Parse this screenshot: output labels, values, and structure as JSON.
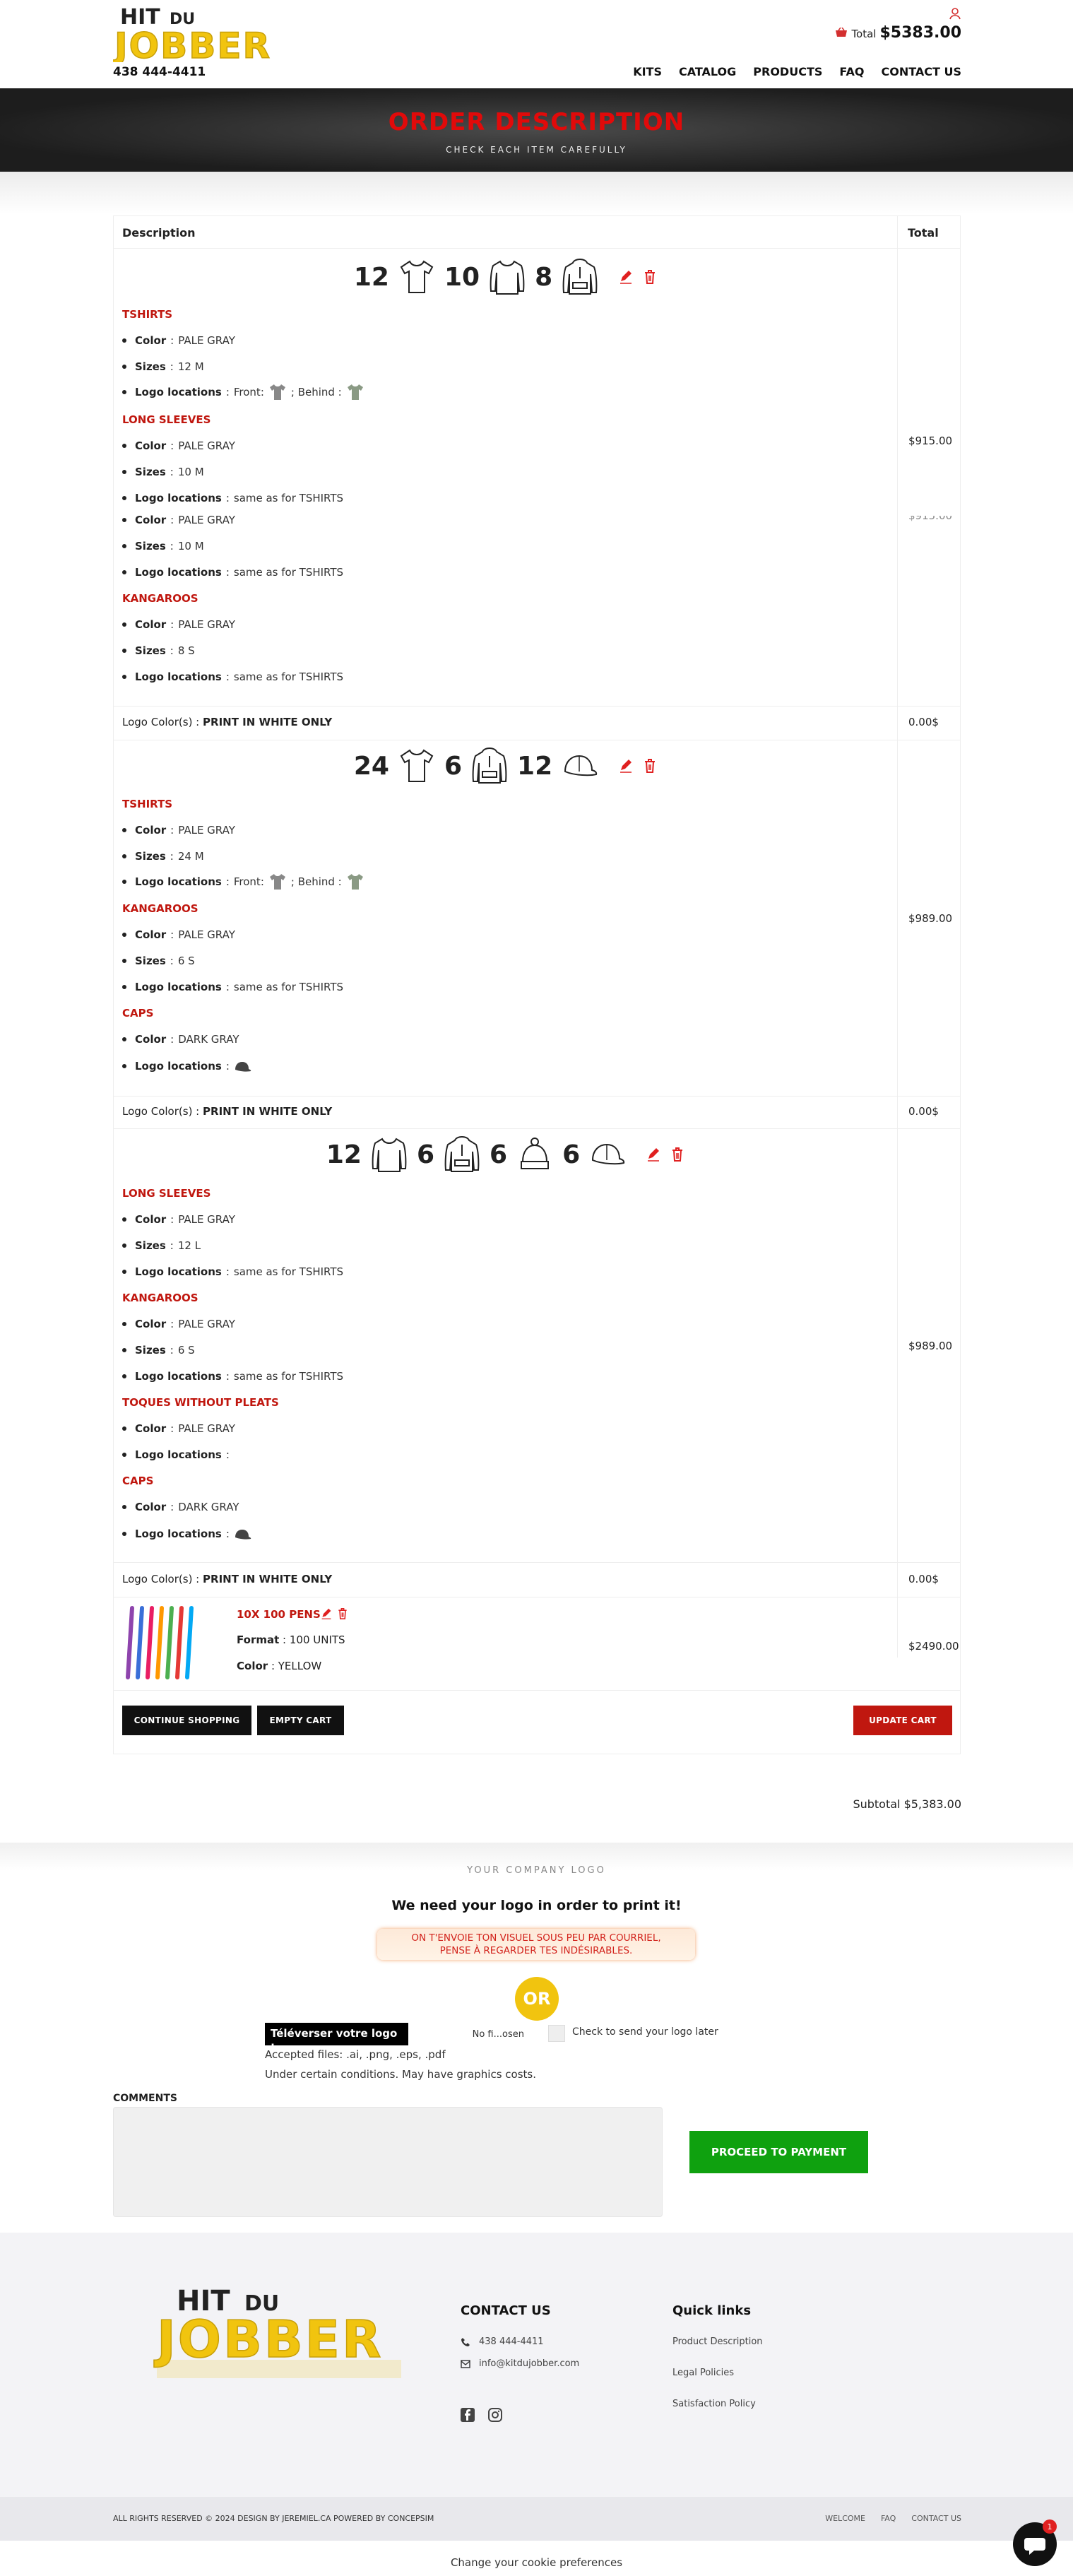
{
  "header": {
    "logo_alt": "Kit du Jobber",
    "phone": "438 444-4411",
    "cart_label": "Total",
    "cart_total": "$5383.00",
    "nav": [
      "KITS",
      "CATALOG",
      "PRODUCTS",
      "FAQ",
      "CONTACT US"
    ]
  },
  "banner": {
    "title": "ORDER DESCRIPTION",
    "subtitle": "CHECK EACH ITEM CAREFULLY"
  },
  "table": {
    "col_description": "Description",
    "col_total": "Total",
    "logo_color_label": "Logo Color(s) :",
    "logo_color_value": "PRINT IN WHITE ONLY",
    "logo_color_price": "0.00$"
  },
  "item1": {
    "quantities": [
      "12",
      "10",
      "8"
    ],
    "price_a": "$915.00",
    "price_b": "$915.00",
    "sections": [
      {
        "title": "TSHIRTS",
        "color": "PALE GRAY",
        "sizes": "12 M",
        "front": "Front:",
        "behind": "; Behind :"
      },
      {
        "title": "LONG SLEEVES",
        "color": "PALE GRAY",
        "sizes": "10 M",
        "logo": "same as for TSHIRTS"
      },
      {
        "title": "",
        "color": "PALE GRAY",
        "sizes": "10 M",
        "logo": "same as for TSHIRTS"
      },
      {
        "title": "KANGAROOS",
        "color": "PALE GRAY",
        "sizes": "8 S",
        "logo": "same as for TSHIRTS"
      }
    ]
  },
  "item2": {
    "quantities": [
      "24",
      "6",
      "12"
    ],
    "price": "$989.00",
    "sections": [
      {
        "title": "TSHIRTS",
        "color": "PALE GRAY",
        "sizes": "24 M",
        "front": "Front:",
        "behind": "; Behind :"
      },
      {
        "title": "KANGAROOS",
        "color": "PALE GRAY",
        "sizes": "6 S",
        "logo": "same as for TSHIRTS"
      },
      {
        "title": "CAPS",
        "color": "DARK GRAY"
      }
    ]
  },
  "item3": {
    "quantities": [
      "12",
      "6",
      "6",
      "6"
    ],
    "price": "$989.00",
    "sections": [
      {
        "title": "LONG SLEEVES",
        "color": "PALE GRAY",
        "sizes": "12 L",
        "logo": "same as for TSHIRTS"
      },
      {
        "title": "KANGAROOS",
        "color": "PALE GRAY",
        "sizes": "6 S",
        "logo": "same as for TSHIRTS"
      },
      {
        "title": "TOQUES WITHOUT PLEATS",
        "color": "PALE GRAY"
      },
      {
        "title": "CAPS",
        "color": "DARK GRAY"
      }
    ]
  },
  "item4": {
    "title": "10X 100 PENS",
    "format_label": "Format",
    "format": "100 UNITS",
    "color_label": "Color",
    "color": "YELLOW",
    "price": "$2490.00"
  },
  "labels": {
    "color": "Color",
    "sizes": "Sizes",
    "logo_locations": "Logo locations"
  },
  "buttons": {
    "continue": "CONTINUE SHOPPING",
    "empty": "EMPTY CART",
    "update": "UPDATE CART"
  },
  "subtotal": "Subtotal $5,383.00",
  "logo_section": {
    "small_title": "YOUR COMPANY LOGO",
    "heading": "We need your logo in order to print it!",
    "badge_line1": "ON T'ENVOIE TON VISUEL SOUS PEU PAR COURRIEL,",
    "badge_line2": "PENSE À REGARDER TES INDÉSIRABLES.",
    "or": "OR",
    "upload_label": "Téléverser votre logo :",
    "file_status": "No fi...osen",
    "checkbox_label": "Check to send your logo later",
    "accepted": "Accepted files: .ai, .png, .eps, .pdf",
    "conditions": "Under certain conditions. May have graphics costs."
  },
  "comments": {
    "title": "COMMENTS",
    "pay_button": "PROCEED TO PAYMENT"
  },
  "footer": {
    "contact_title": "CONTACT US",
    "phone": "438 444-4411",
    "email": "info@kitdujobber.com",
    "links_title": "Quick links",
    "links": [
      "Product Description",
      "Legal Policies",
      "Satisfaction Policy"
    ],
    "copyright": "ALL RIGHTS RESERVED © 2024 DESIGN BY JEREMIEL.CA POWERED BY CONCEPSIM",
    "bottom_links": [
      "WELCOME",
      "FAQ",
      "CONTACT US"
    ],
    "cookie": "Change your cookie preferences",
    "chat_badge": "1"
  },
  "colors": {
    "accent_red": "#c0170f",
    "banner_red": "#e10a0a",
    "brand_yellow": "#f1c40f",
    "pay_green": "#0fa10f"
  },
  "icons": [
    "user-icon",
    "cart-icon",
    "edit-icon",
    "trash-icon",
    "tshirt-icon",
    "long-sleeve-icon",
    "hoodie-icon",
    "cap-icon",
    "toque-icon",
    "phone-icon",
    "mail-icon",
    "facebook-icon",
    "instagram-icon",
    "chat-icon"
  ]
}
